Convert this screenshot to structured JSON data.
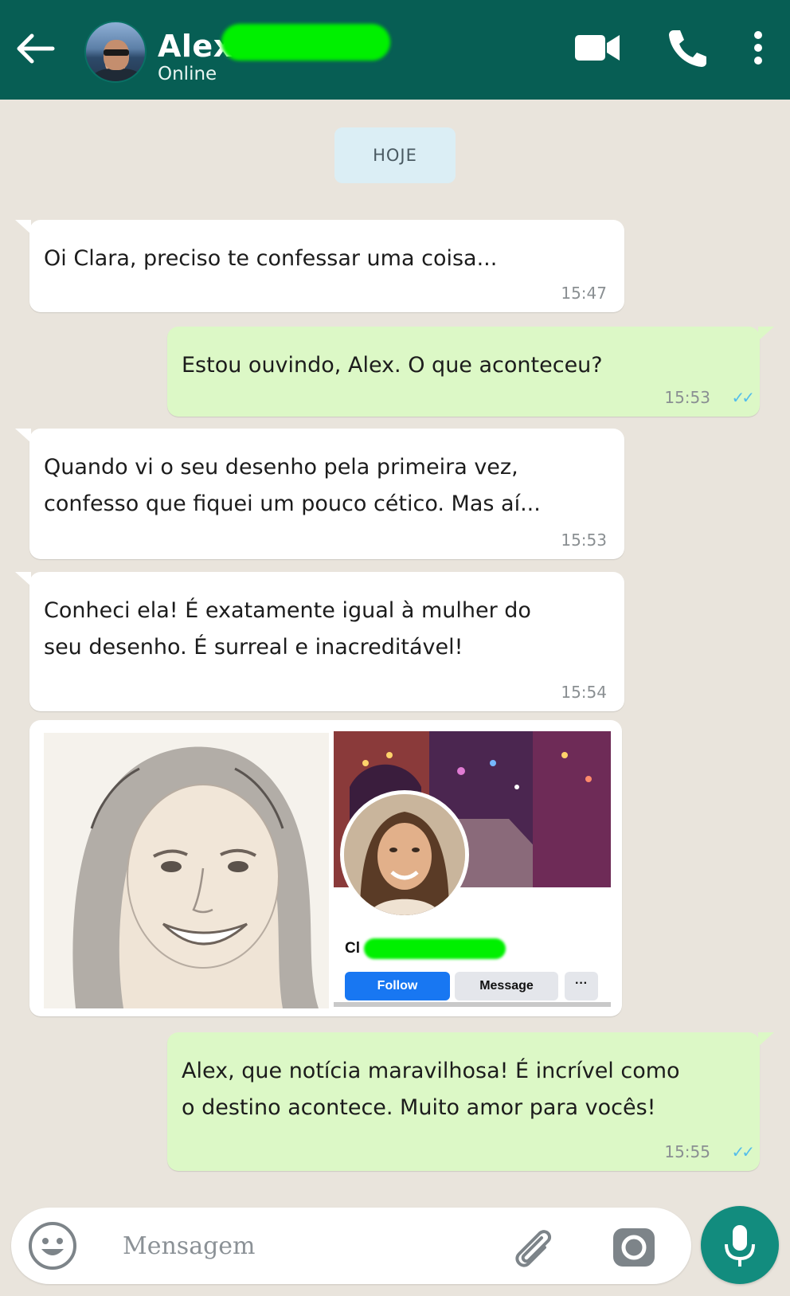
{
  "header": {
    "contact_name": "Alex",
    "status": "Online"
  },
  "chat": {
    "date_label": "HOJE",
    "messages": [
      {
        "direction": "in",
        "text": "Oi Clara, preciso te confessar uma coisa...",
        "time": "15:47"
      },
      {
        "direction": "out",
        "text": "Estou ouvindo, Alex. O que aconteceu?",
        "time": "15:53",
        "ticks": "✓✓"
      },
      {
        "direction": "in",
        "line1": "Quando vi o seu desenho pela primeira vez,",
        "line2": "confesso que fiquei um pouco cético. Mas aí...",
        "time": "15:53"
      },
      {
        "direction": "in",
        "line1": "Conheci ela! É exatamente igual à mulher do",
        "line2": "seu desenho. É surreal e inacreditável!",
        "time": "15:54"
      },
      {
        "direction": "out",
        "line1": "Alex, que notícia maravilhosa! É incrível como",
        "line2": "o destino acontece. Muito amor para vocês!",
        "time": "15:55",
        "ticks": "✓✓"
      }
    ],
    "image_card": {
      "fb_name_visible": "Cl",
      "follow_label": "Follow",
      "message_label": "Message",
      "more_label": "···"
    }
  },
  "composer": {
    "placeholder": "Mensagem"
  },
  "colors": {
    "header": "#075e54",
    "outgoing_bubble": "#dcf8c6",
    "incoming_bubble": "#ffffff",
    "mic_button": "#128c7e",
    "read_ticks": "#53bdeb"
  },
  "icons": [
    "back-arrow-icon",
    "video-call-icon",
    "phone-icon",
    "more-vert-icon",
    "emoji-icon",
    "attach-icon",
    "camera-icon",
    "mic-icon"
  ]
}
